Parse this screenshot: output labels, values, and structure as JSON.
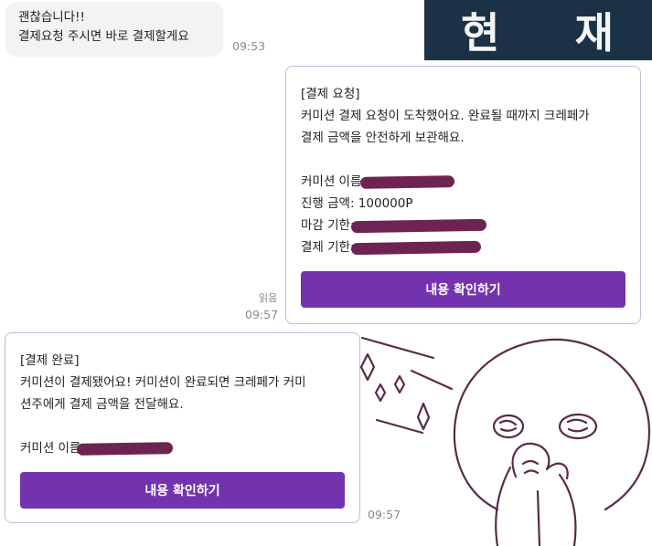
{
  "msg1": {
    "line1": "괜찮습니다!!",
    "line2": "결제요청 주시면 바로 결제할게요",
    "time": "09:53"
  },
  "banner": {
    "char1": "현",
    "char2": "재"
  },
  "card1": {
    "title": "[결제 요청]",
    "body1": "커미션 결제 요청이 도착했어요. 완료될 때까지 크레페가",
    "body2": "결제 금액을 안전하게 보관해요.",
    "name_label": "커미션 이름:",
    "amount_label": "진행 금액: 100000P",
    "deadline_label": "마감 기한:",
    "pay_deadline_label": "결제 기한:",
    "button": "내용 확인하기",
    "read": "읽음",
    "time": "09:57"
  },
  "card2": {
    "title": "[결제 완료]",
    "body1": "커미션이 결제됐어요! 커미션이 완료되면 크레페가 커미",
    "body2": "션주에게 결제 금액을 전달해요.",
    "name_label": "커미션 이름",
    "button": "내용 확인하기",
    "time": "09:57"
  },
  "colors": {
    "accent": "#7433ae",
    "card_border": "#c9b8d8",
    "redaction": "#6e2452",
    "banner_bg": "#1b3246",
    "doodle": "#5a2a4a"
  }
}
